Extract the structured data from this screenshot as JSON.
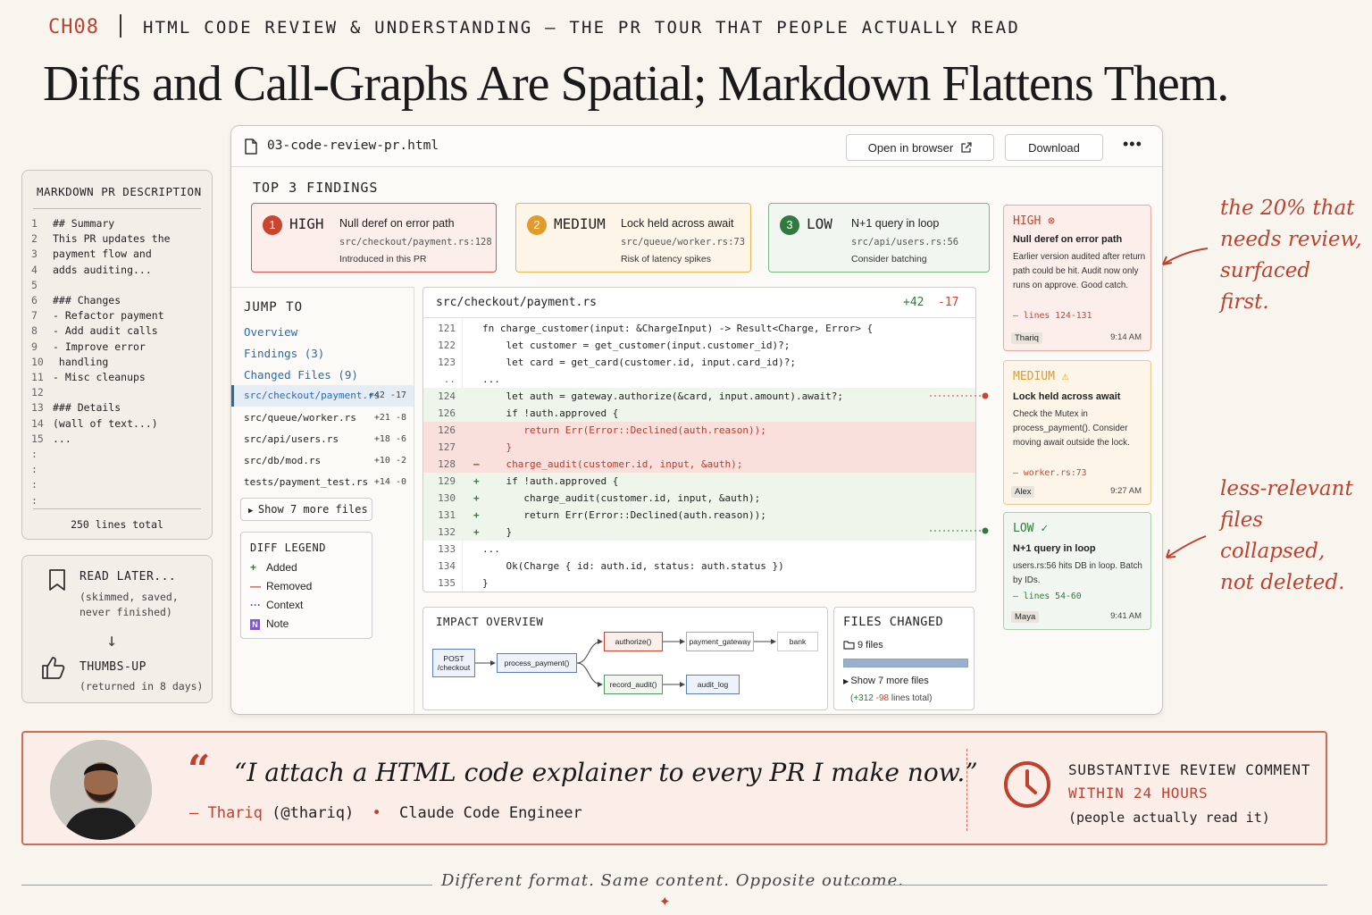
{
  "header": {
    "chapter": "CH08",
    "subtitle": "HTML CODE REVIEW & UNDERSTANDING — THE PR TOUR THAT PEOPLE ACTUALLY READ",
    "title": "Diffs and Call-Graphs Are Spatial; Markdown Flattens Them."
  },
  "markdown_card": {
    "title": "MARKDOWN PR DESCRIPTION",
    "lines": [
      {
        "n": "1",
        "t": "## Summary"
      },
      {
        "n": "2",
        "t": "This PR updates the"
      },
      {
        "n": "3",
        "t": "payment flow and"
      },
      {
        "n": "4",
        "t": "adds auditing..."
      },
      {
        "n": "5",
        "t": ""
      },
      {
        "n": "6",
        "t": "### Changes"
      },
      {
        "n": "7",
        "t": "- Refactor payment"
      },
      {
        "n": "8",
        "t": "- Add audit calls"
      },
      {
        "n": "9",
        "t": "- Improve error"
      },
      {
        "n": "10",
        "t": "  handling"
      },
      {
        "n": "11",
        "t": "- Misc cleanups"
      },
      {
        "n": "12",
        "t": ""
      },
      {
        "n": "13",
        "t": "### Details"
      },
      {
        "n": "14",
        "t": "(wall of text...)"
      },
      {
        "n": "15",
        "t": "..."
      },
      {
        "n": ":",
        "t": ""
      },
      {
        "n": ":",
        "t": ""
      },
      {
        "n": ":",
        "t": ""
      },
      {
        "n": ":",
        "t": ""
      }
    ],
    "total": "250 lines total"
  },
  "read_card": {
    "read_label": "READ LATER...",
    "read_sub": "(skimmed, saved, never finished)",
    "thumb_label": "THUMBS-UP",
    "thumb_sub": "(returned in 8 days)"
  },
  "window": {
    "filename": "03-code-review-pr.html",
    "open_label": "Open in browser",
    "download_label": "Download",
    "more_label": "•••"
  },
  "findings": {
    "header": "TOP 3 FINDINGS",
    "items": [
      {
        "num": "1",
        "severity": "HIGH",
        "title": "Null deref on error path",
        "path": "src/checkout/payment.rs:128",
        "note": "Introduced in this PR"
      },
      {
        "num": "2",
        "severity": "MEDIUM",
        "title": "Lock held across await",
        "path": "src/queue/worker.rs:73",
        "note": "Risk of latency spikes"
      },
      {
        "num": "3",
        "severity": "LOW",
        "title": "N+1 query in loop",
        "path": "src/api/users.rs:56",
        "note": "Consider batching"
      }
    ]
  },
  "jump": {
    "header": "JUMP TO",
    "links": [
      "Overview",
      "Findings (3)",
      "Changed Files (9)"
    ],
    "files": [
      {
        "name": "src/checkout/payment.rs",
        "delta": "+42 -17"
      },
      {
        "name": "src/queue/worker.rs",
        "delta": "+21 -8"
      },
      {
        "name": "src/api/users.rs",
        "delta": "+18 -6"
      },
      {
        "name": "src/db/mod.rs",
        "delta": "+10 -2"
      },
      {
        "name": "tests/payment_test.rs",
        "delta": "+14 -0"
      }
    ],
    "show_more": "Show 7 more files"
  },
  "legend": {
    "header": "DIFF LEGEND",
    "items": [
      {
        "sym": "+",
        "label": "Added",
        "color": "#2f7a3f"
      },
      {
        "sym": "—",
        "label": "Removed",
        "color": "#c8462f"
      },
      {
        "sym": "···",
        "label": "Context",
        "color": "#2a6ab0"
      },
      {
        "sym": "N",
        "label": "Note",
        "color": "#7b5cc4"
      }
    ]
  },
  "diff": {
    "file": "src/checkout/payment.rs",
    "added": "+42",
    "removed": "-17",
    "lines": [
      {
        "n": "121",
        "s": "",
        "t": "fn charge_customer(input: &ChargeInput) -> Result<Charge, Error> {",
        "k": "ctx"
      },
      {
        "n": "122",
        "s": "",
        "t": "    let customer = get_customer(input.customer_id)?;",
        "k": "ctx"
      },
      {
        "n": "123",
        "s": "",
        "t": "    let card = get_card(customer.id, input.card_id)?;",
        "k": "ctx"
      },
      {
        "n": "..",
        "s": "",
        "t": "...",
        "k": "ctx"
      },
      {
        "n": "124",
        "s": "",
        "t": "    let auth = gateway.authorize(&card, input.amount).await?;",
        "k": "add"
      },
      {
        "n": "126",
        "s": "",
        "t": "    if !auth.approved {",
        "k": "add"
      },
      {
        "n": "126",
        "s": "",
        "t": "       return Err(Error::Declined(auth.reason));",
        "k": "del"
      },
      {
        "n": "127",
        "s": "",
        "t": "    }",
        "k": "del"
      },
      {
        "n": "128",
        "s": "–",
        "t": "    charge_audit(customer.id, input, &auth);",
        "k": "del"
      },
      {
        "n": "129",
        "s": "+",
        "t": "    if !auth.approved {",
        "k": "add"
      },
      {
        "n": "130",
        "s": "+",
        "t": "       charge_audit(customer.id, input, &auth);",
        "k": "add"
      },
      {
        "n": "131",
        "s": "+",
        "t": "       return Err(Error::Declined(auth.reason));",
        "k": "add"
      },
      {
        "n": "132",
        "s": "+",
        "t": "    }",
        "k": "add"
      },
      {
        "n": "133",
        "s": "",
        "t": "...",
        "k": "ctx"
      },
      {
        "n": "134",
        "s": "",
        "t": "    Ok(Charge { id: auth.id, status: auth.status })",
        "k": "ctx"
      },
      {
        "n": "135",
        "s": "",
        "t": "}",
        "k": "ctx"
      }
    ]
  },
  "impact": {
    "header": "IMPACT OVERVIEW",
    "nodes": {
      "post": "POST\n/checkout",
      "process": "process_payment()",
      "authorize": "authorize()",
      "gateway": "payment_gateway",
      "bank": "bank",
      "record": "record_audit()",
      "audit": "audit_log"
    }
  },
  "files_changed": {
    "header": "FILES CHANGED",
    "count": "9 files",
    "show_more": "Show 7 more files",
    "total_add": "(+312",
    "total_del": "-98",
    "total_rest": "lines total)"
  },
  "comments": [
    {
      "sev": "HIGH",
      "icon": "⊗",
      "title": "Null deref on error path",
      "body": "Earlier version audited after return path could be hit. Audit now only runs on approve. Good catch.",
      "ref": "— lines 124-131",
      "user": "Thariq",
      "time": "9:14 AM"
    },
    {
      "sev": "MEDIUM",
      "icon": "⚠",
      "title": "Lock held across await",
      "body": "Check the Mutex in process_payment(). Consider moving await outside the lock.",
      "ref": "— worker.rs:73",
      "user": "Alex",
      "time": "9:27 AM"
    },
    {
      "sev": "LOW",
      "icon": "✓",
      "title": "N+1 query in loop",
      "body": "users.rs:56 hits DB in loop. Batch by IDs.",
      "ref": "— lines 54-60",
      "user": "Maya",
      "time": "9:41 AM"
    }
  ],
  "annotations": {
    "top": "the 20% that needs review, surfaced first.",
    "bottom": "less-relevant files collapsed, not deleted."
  },
  "quote": {
    "mark": "“",
    "text": "“I attach a HTML code explainer to every PR I make now.”",
    "author_prefix": "— Thariq",
    "handle": "(@thariq)",
    "bullet": "•",
    "role": "Claude Code Engineer",
    "stat_line1": "SUBSTANTIVE REVIEW COMMENT",
    "stat_line2": "WITHIN 24 HOURS",
    "stat_line3": "(people actually read it)"
  },
  "footer": {
    "text": "Different format. Same content. Opposite outcome.",
    "star": "✦"
  },
  "colors": {
    "accent": "#c0402e",
    "high": "#c8462f",
    "medium": "#e39a2c",
    "low": "#2f7a3f",
    "link": "#2a6ab0"
  }
}
